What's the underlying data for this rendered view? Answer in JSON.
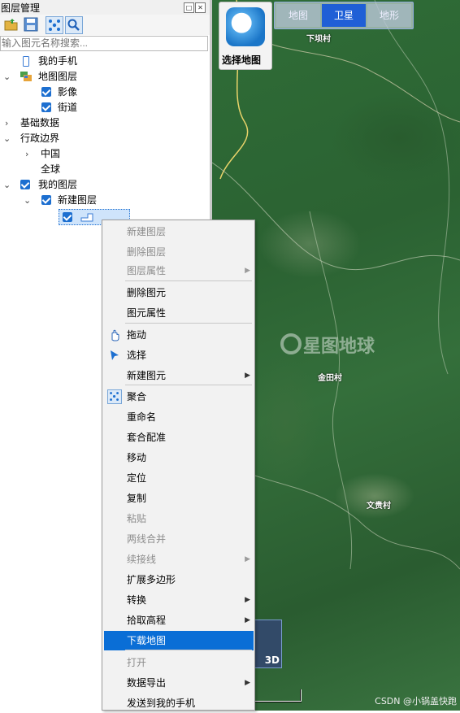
{
  "panel": {
    "title": "图层管理",
    "pin_glyph": "□",
    "close_glyph": "✕",
    "search_placeholder": "输入图元名称搜索..."
  },
  "tree": {
    "my_phone": "我的手机",
    "map_layers": "地图图层",
    "imagery": "影像",
    "streets": "街道",
    "base_data": "基础数据",
    "admin_boundary": "行政边界",
    "china": "中国",
    "global": "全球",
    "my_layers": "我的图层",
    "new_layer": "新建图层"
  },
  "map": {
    "select_label": "选择地图",
    "tabs": [
      "地图",
      "卫星",
      "地形"
    ],
    "active_tab": "卫星",
    "places": [
      "下坝村",
      "金田村",
      "文贵村"
    ],
    "watermark": "星图地球",
    "globe_badge": "3D",
    "credit": "CSDN @小锅盖快跑"
  },
  "context_menu": {
    "items": [
      {
        "label": "新建图层",
        "disabled": true
      },
      {
        "label": "删除图层",
        "disabled": true
      },
      {
        "label": "图层属性",
        "disabled": true,
        "submenu": true
      },
      {
        "label": "删除图元"
      },
      {
        "label": "图元属性"
      },
      {
        "label": "拖动",
        "icon": "hand-icon"
      },
      {
        "label": "选择",
        "icon": "pointer-icon"
      },
      {
        "label": "新建图元",
        "submenu": true
      },
      {
        "label": "聚合",
        "icon": "cluster-icon"
      },
      {
        "label": "重命名"
      },
      {
        "label": "套合配准"
      },
      {
        "label": "移动"
      },
      {
        "label": "定位"
      },
      {
        "label": "复制"
      },
      {
        "label": "粘贴",
        "disabled": true
      },
      {
        "label": "两线合并",
        "disabled": true
      },
      {
        "label": "续接线",
        "disabled": true,
        "submenu": true
      },
      {
        "label": "扩展多边形"
      },
      {
        "label": "转换",
        "submenu": true
      },
      {
        "label": "拾取高程",
        "submenu": true
      },
      {
        "label": "下载地图",
        "highlighted": true
      },
      {
        "label": "打开",
        "disabled": true
      },
      {
        "label": "数据导出",
        "submenu": true
      },
      {
        "label": "发送到我的手机"
      }
    ],
    "submenu_glyph": "▶"
  },
  "colors": {
    "accent": "#0a6ed6",
    "checkbox": "#1d6fd0",
    "active_tab": "#1f5fd6"
  }
}
